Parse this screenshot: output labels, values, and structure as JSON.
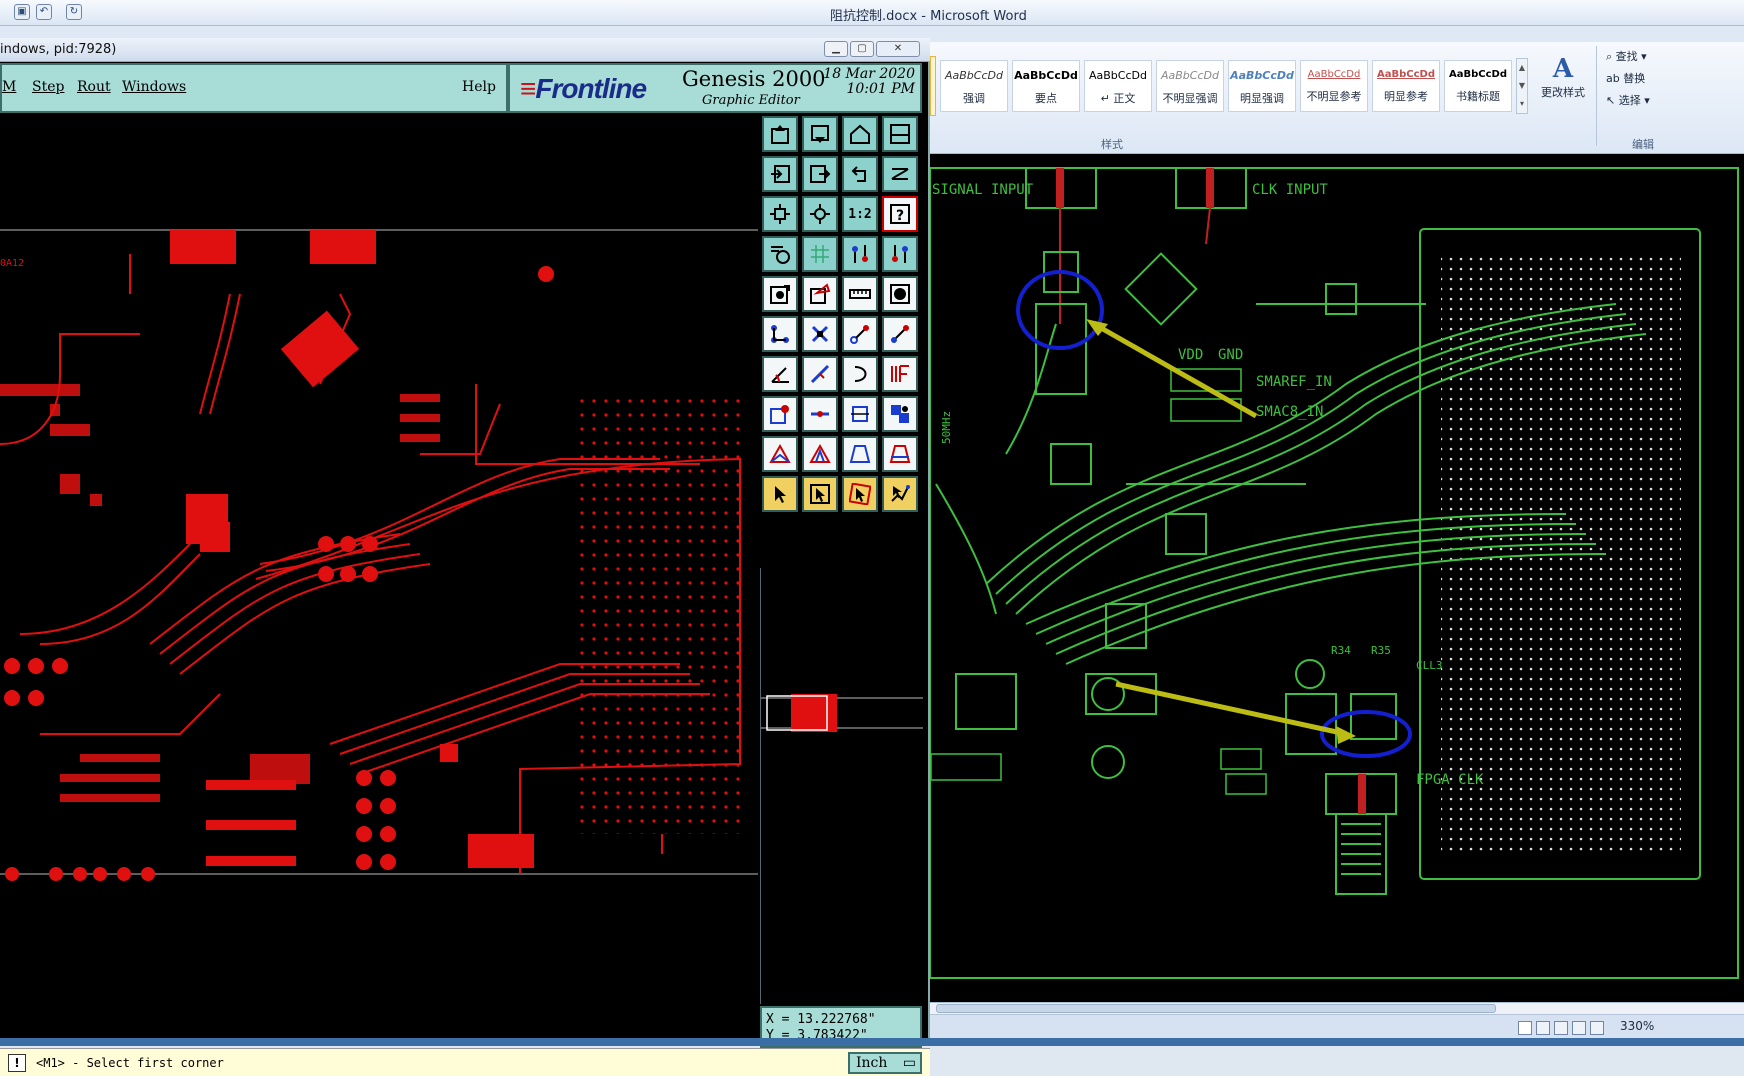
{
  "word": {
    "title": "阻抗控制.docx - Microsoft Word",
    "styles": [
      {
        "preview": "AaBbCcDd",
        "name": "强调"
      },
      {
        "preview": "AaBbCcDd",
        "name": "要点"
      },
      {
        "preview": "AaBbCcDd",
        "name": "↵ 正文"
      },
      {
        "preview": "AaBbCcDd",
        "name": "不明显强调"
      },
      {
        "preview": "AaBbCcDd",
        "name": "明显强调"
      },
      {
        "preview": "AaBbCcDd",
        "name": "不明显参考"
      },
      {
        "preview": "AaBbCcDd",
        "name": "明显参考"
      },
      {
        "preview": "AaBbCcDd",
        "name": "书籍标题"
      }
    ],
    "change_styles": "更改样式",
    "styles_group_label": "样式",
    "edit_group": {
      "find": "查找",
      "replace": "替换",
      "select": "选择",
      "label": "编辑"
    },
    "zoom": "330%",
    "pcb_labels": [
      "SIGNAL INPUT",
      "CLK INPUT",
      "VDD",
      "GND",
      "SMAREF_IN",
      "SMAC8_IN",
      "FPGA CLK",
      "CLL3",
      "R35",
      "R34",
      "50MHz"
    ]
  },
  "genesis": {
    "caption": "indows, pid:7928)",
    "menu": [
      "M",
      "Step",
      "Rout",
      "Windows"
    ],
    "help": "Help",
    "logo": "Frontline",
    "product": "Genesis 2000",
    "subtitle": "Graphic Editor",
    "date": "18 Mar 2020",
    "time": "10:01 PM",
    "coord_x": "X = 13.222768\"",
    "coord_y": "Y = 3.783422\"",
    "status": "<M1> - Select first corner",
    "units": "Inch",
    "tool_scale_label": "1:2",
    "ref_label": "0A12"
  }
}
